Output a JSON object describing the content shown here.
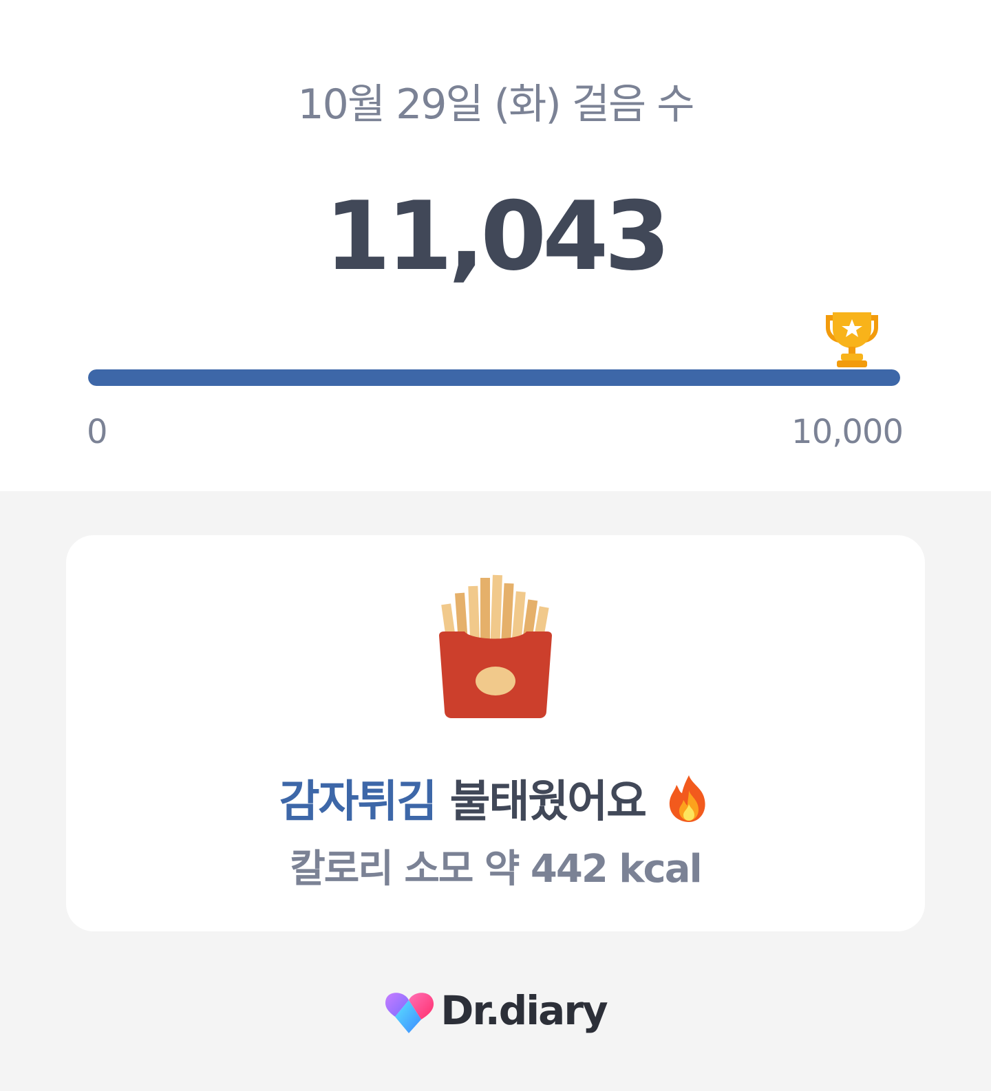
{
  "header": {
    "date_title": "10월 29일 (화) 걸음 수",
    "step_count": "11,043"
  },
  "progress": {
    "min_label": "0",
    "max_label": "10,000",
    "fill_fraction": 1.0,
    "fill_color": "#3d67a8",
    "goal_icon": "trophy-icon"
  },
  "card": {
    "food_icon": "french-fries-icon",
    "food_name": "감자튀김",
    "burned_text": "불태웠어요",
    "fire_icon": "fire-icon",
    "calorie_text": "칼로리 소모 약 442 kcal"
  },
  "footer": {
    "logo_text": "Dr.diary",
    "logo_icon": "heart-logo-icon"
  }
}
